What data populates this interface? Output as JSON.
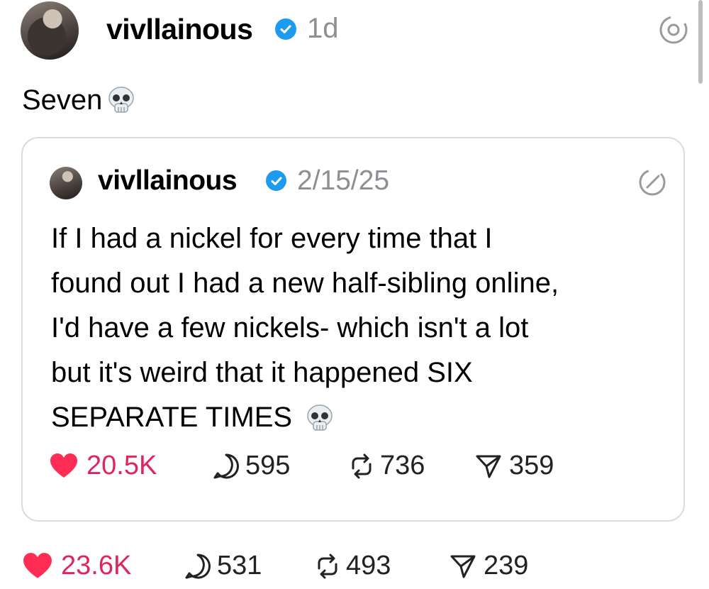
{
  "post": {
    "author": "vivllainous",
    "time": "1d",
    "text": "Seven",
    "stats": {
      "likes": "23.6K",
      "replies": "531",
      "reposts": "493",
      "shares": "239"
    }
  },
  "quoted": {
    "author": "vivllainous",
    "date": "2/15/25",
    "lines": [
      "If I had a nickel for every time that I",
      "found out I had a new half-sibling online,",
      "I'd have a few nickels- which isn't a lot",
      "but it's weird that it happened SIX",
      "SEPARATE TIMES"
    ],
    "stats": {
      "likes": "20.5K",
      "replies": "595",
      "reposts": "736",
      "shares": "359"
    }
  },
  "colors": {
    "like": "#e0245e",
    "verified": "#1d9bf0",
    "muted": "#8e8e93"
  },
  "icons": [
    "verified-icon",
    "threads-icon",
    "skull-emoji",
    "edit-icon",
    "heart-icon",
    "reply-icon",
    "repost-icon",
    "share-icon"
  ]
}
